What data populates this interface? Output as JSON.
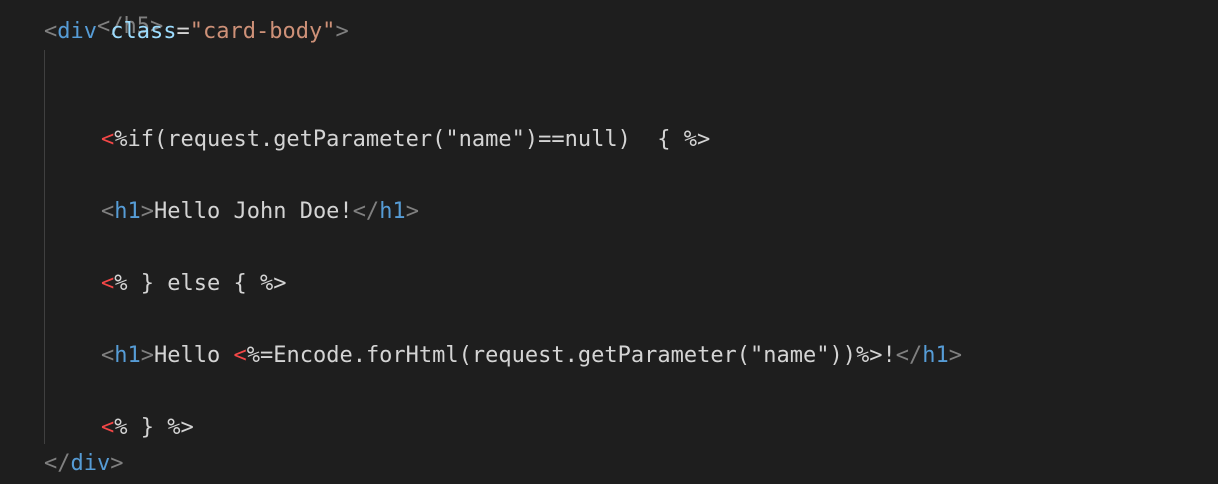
{
  "editor": {
    "top_partial": "</h5>",
    "lines": {
      "div_open": {
        "lt": "<",
        "tag": "div",
        "attr": "class",
        "eq": "=",
        "value": "\"card-body\"",
        "gt": ">"
      },
      "if_line": {
        "open": "<",
        "code": "%if(request.getParameter(\"name\")==null)  { %>"
      },
      "h1_first": {
        "lt1": "<",
        "tag1": "h1",
        "gt1": ">",
        "text": "Hello John Doe!",
        "lt2": "</",
        "tag2": "h1",
        "gt2": ">"
      },
      "else_line": {
        "open": "<",
        "code": "% } else { %>"
      },
      "h1_second": {
        "lt1": "<",
        "tag1": "h1",
        "gt1": ">",
        "text": "Hello ",
        "open": "<",
        "code": "%=Encode.forHtml(request.getParameter(\"name\"))%>!",
        "lt2": "</",
        "tag2": "h1",
        "gt2": ">"
      },
      "close_line": {
        "open": "<",
        "code": "% } %>"
      },
      "div_close": {
        "lt": "</",
        "tag": "div",
        "gt": ">"
      }
    }
  }
}
